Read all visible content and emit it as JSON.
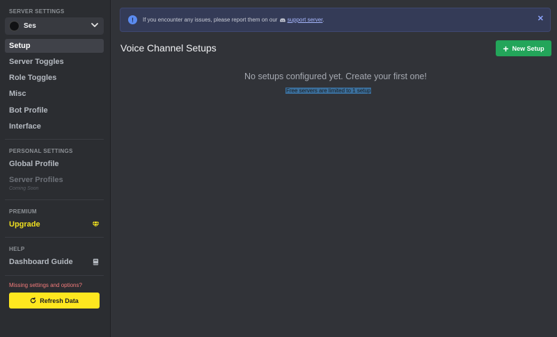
{
  "sidebar": {
    "server_settings_label": "SERVER SETTINGS",
    "server_name": "Ses",
    "nav": [
      {
        "label": "Setup"
      },
      {
        "label": "Server Toggles"
      },
      {
        "label": "Role Toggles"
      },
      {
        "label": "Misc"
      },
      {
        "label": "Bot Profile"
      },
      {
        "label": "Interface"
      }
    ],
    "personal_settings_label": "PERSONAL SETTINGS",
    "personal": [
      {
        "label": "Global Profile"
      },
      {
        "label": "Server Profiles",
        "note": "Coming Soon"
      }
    ],
    "premium_label": "PREMIUM",
    "upgrade_label": "Upgrade",
    "help_label": "HELP",
    "guide_label": "Dashboard Guide",
    "missing_text": "Missing settings and options?",
    "refresh_label": "Refresh Data"
  },
  "banner": {
    "text_before": "If you encounter any issues, please report them on our",
    "link_text": "support server",
    "text_after": ".",
    "close": "✕"
  },
  "main": {
    "title": "Voice Channel Setups",
    "new_setup_label": "New Setup",
    "empty_message": "No setups configured yet. Create your first one!",
    "limit_note": "Free servers are limited to 1 setup"
  },
  "colors": {
    "accent_yellow": "#fee71f",
    "success_green": "#23a55a",
    "info_blue": "#5b8bf0"
  },
  "icons": {
    "chevron": "chevron-down-icon",
    "diamond": "diamond-icon",
    "book": "book-icon",
    "refresh": "refresh-icon",
    "info": "info-icon",
    "close": "close-icon",
    "plus": "plus-icon"
  }
}
